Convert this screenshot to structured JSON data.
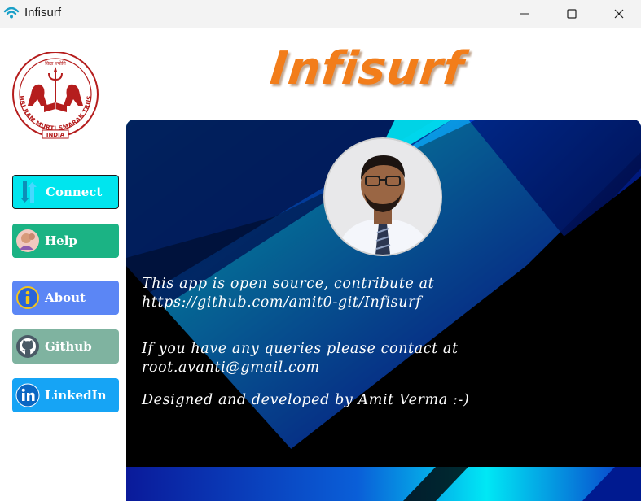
{
  "window": {
    "title": "Infisurf",
    "icon": "wifi-icon",
    "controls": [
      "minimize-icon",
      "maximize-icon",
      "close-icon"
    ]
  },
  "header": {
    "brand": "Infisurf",
    "logo": {
      "icon": "shri-ram-murti-smarak-trust-emblem",
      "text": "SHRI RAM MURTI SMARAK TRUST",
      "subtext": "INDIA"
    }
  },
  "sidebar": {
    "items": [
      {
        "label": "Connect",
        "icon": "updown-arrows-icon",
        "color": "#00e5ee"
      },
      {
        "label": "Help",
        "icon": "help-person-icon",
        "color": "#1bb384"
      },
      {
        "label": "About",
        "icon": "info-icon",
        "color": "#5b86f5"
      },
      {
        "label": "Github",
        "icon": "github-icon",
        "color": "#7fb3a0"
      },
      {
        "label": "LinkedIn",
        "icon": "linkedin-icon",
        "color": "#16a4f5"
      }
    ]
  },
  "main": {
    "avatar": "profile-photo",
    "line1": "This app is open source, contribute at https://github.com/amit0-git/Infisurf",
    "line2": "If you have any queries please contact at root.avanti@gmail.com",
    "line3": "Designed and developed by Amit Verma :-)"
  },
  "colors": {
    "brand": "#f27d1a",
    "panel_dark": "#000000",
    "panel_cyan": "#00e0f0",
    "panel_blue": "#0a1fc7"
  }
}
